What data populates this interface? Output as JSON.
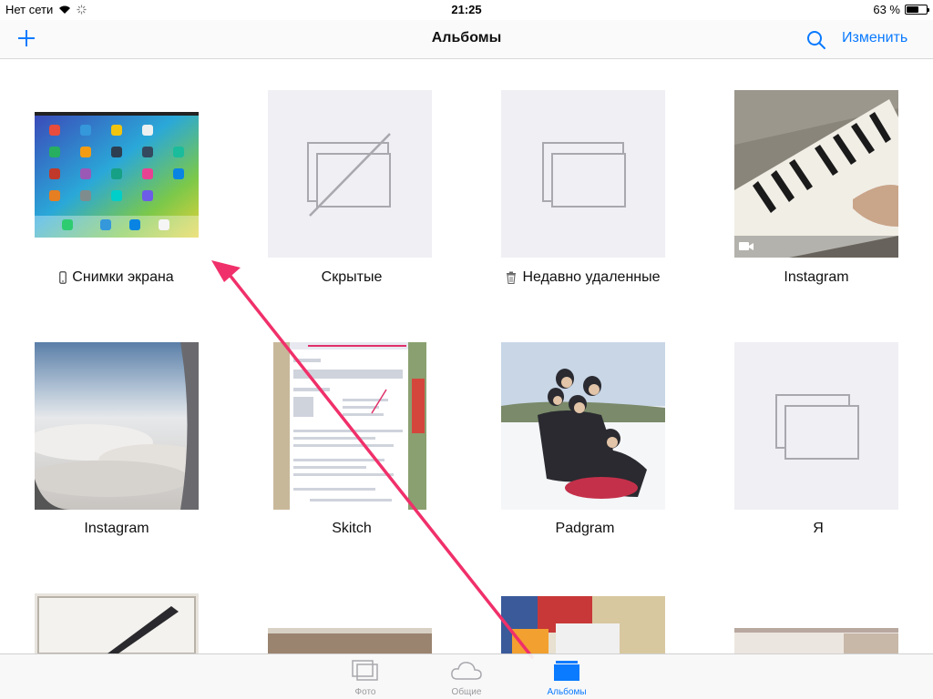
{
  "status_bar": {
    "carrier": "Нет сети",
    "time": "21:25",
    "battery_text": "63 %",
    "battery_level": 0.63,
    "wifi_icon": "wifi-icon",
    "loading_icon": "activity-spinner-icon"
  },
  "nav": {
    "title": "Альбомы",
    "edit_label": "Изменить",
    "add_icon": "plus-icon",
    "search_icon": "search-icon"
  },
  "albums": [
    {
      "title": "Снимки экрана",
      "icon": "screenshot-phone-icon",
      "thumb": "screenshot-home-screen"
    },
    {
      "title": "Скрытые",
      "icon": "",
      "thumb": "empty-hidden"
    },
    {
      "title": "Недавно удаленные",
      "icon": "trash-icon",
      "thumb": "empty"
    },
    {
      "title": "Instagram",
      "icon": "",
      "thumb": "piano-video"
    },
    {
      "title": "Instagram",
      "icon": "",
      "thumb": "clouds-photo"
    },
    {
      "title": "Skitch",
      "icon": "",
      "thumb": "skitch-document"
    },
    {
      "title": "Padgram",
      "icon": "",
      "thumb": "group-snow-photo"
    },
    {
      "title": "Я",
      "icon": "",
      "thumb": "empty"
    }
  ],
  "tabs": [
    {
      "label": "Фото",
      "icon": "photos-icon",
      "active": false
    },
    {
      "label": "Общие",
      "icon": "cloud-icon",
      "active": false
    },
    {
      "label": "Альбомы",
      "icon": "albums-folder-icon",
      "active": true
    }
  ],
  "annotation": {
    "icon": "pink-arrow-icon",
    "color": "#f0306a"
  },
  "colors": {
    "accent": "#0a7aff",
    "empty_bg": "#efeff4",
    "empty_stroke": "#a8a8ae"
  }
}
